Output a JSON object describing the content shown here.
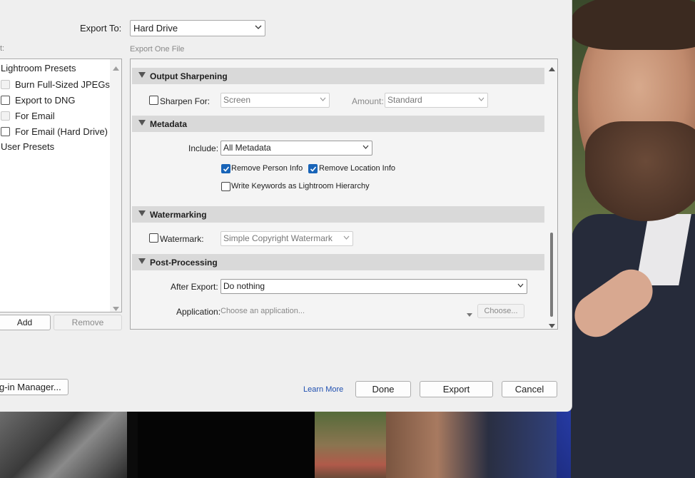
{
  "dialog": {
    "export_to_label": "Export To:",
    "export_to_value": "Hard Drive",
    "export_one_file": "Export One File",
    "preset_header": "t:"
  },
  "presets": {
    "items": [
      {
        "label": "Lightroom Presets",
        "type": "folder"
      },
      {
        "label": "Burn Full-Sized JPEGs",
        "type": "check",
        "checked": false,
        "disabled": true
      },
      {
        "label": "Export to DNG",
        "type": "check",
        "checked": false,
        "disabled": false
      },
      {
        "label": "For Email",
        "type": "check",
        "checked": false,
        "disabled": true
      },
      {
        "label": "For Email (Hard Drive)",
        "type": "check",
        "checked": false,
        "disabled": false
      },
      {
        "label": "User Presets",
        "type": "folder"
      }
    ],
    "add_label": "Add",
    "remove_label": "Remove"
  },
  "sections": {
    "output_sharpening": {
      "title": "Output Sharpening",
      "sharpen_for_label": "Sharpen For:",
      "sharpen_for_value": "Screen",
      "amount_label": "Amount:",
      "amount_value": "Standard",
      "sharpen_checked": false
    },
    "metadata": {
      "title": "Metadata",
      "include_label": "Include:",
      "include_value": "All Metadata",
      "remove_person": "Remove Person Info",
      "remove_person_checked": true,
      "remove_location": "Remove Location Info",
      "remove_location_checked": true,
      "write_keywords": "Write Keywords as Lightroom Hierarchy",
      "write_keywords_checked": false
    },
    "watermarking": {
      "title": "Watermarking",
      "watermark_label": "Watermark:",
      "watermark_value": "Simple Copyright Watermark",
      "watermark_checked": false
    },
    "post_processing": {
      "title": "Post-Processing",
      "after_export_label": "After Export:",
      "after_export_value": "Do nothing",
      "application_label": "Application:",
      "application_placeholder": "Choose an application...",
      "choose_label": "Choose..."
    }
  },
  "footer": {
    "plugin_manager": "g-in Manager...",
    "learn_more": "Learn More",
    "done": "Done",
    "export": "Export",
    "cancel": "Cancel"
  },
  "colors": {
    "checkbox_checked": "#1864b8",
    "section_header": "#d9d9d9",
    "learn_more_link": "#1f4fb0"
  }
}
